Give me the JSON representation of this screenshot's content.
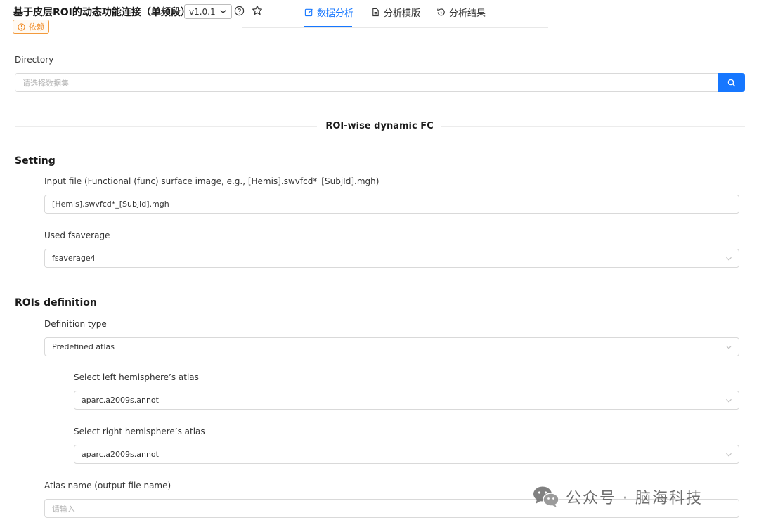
{
  "header": {
    "title": "基于皮层ROI的动态功能连接（单频段）",
    "version": "v1.0.1",
    "badge": "依赖"
  },
  "tabs": [
    {
      "label": "数据分析",
      "active": true
    },
    {
      "label": "分析模版",
      "active": false
    },
    {
      "label": "分析结果",
      "active": false
    }
  ],
  "directory": {
    "label": "Directory",
    "placeholder": "请选择数据集"
  },
  "section_divider": "ROI-wise dynamic FC",
  "setting": {
    "title": "Setting",
    "input_file_label": "Input file (Functional (func) surface image, e.g., [Hemis].swvfcd*_[SubjId].mgh)",
    "input_file_value": "[Hemis].swvfcd*_[SubjId].mgh",
    "fsaverage_label": "Used fsaverage",
    "fsaverage_value": "fsaverage4"
  },
  "rois": {
    "title": "ROIs definition",
    "definition_type_label": "Definition type",
    "definition_type_value": "Predefined atlas",
    "left_atlas_label": "Select left hemisphere’s atlas",
    "left_atlas_value": "aparc.a2009s.annot",
    "right_atlas_label": "Select right hemisphere’s atlas",
    "right_atlas_value": "aparc.a2009s.annot",
    "atlas_name_label": "Atlas name (output file name)",
    "atlas_name_placeholder": "请输入"
  },
  "watermark": "公众号 · 脑海科技",
  "colors": {
    "accent": "#1677ff",
    "badge": "#f08a24"
  }
}
